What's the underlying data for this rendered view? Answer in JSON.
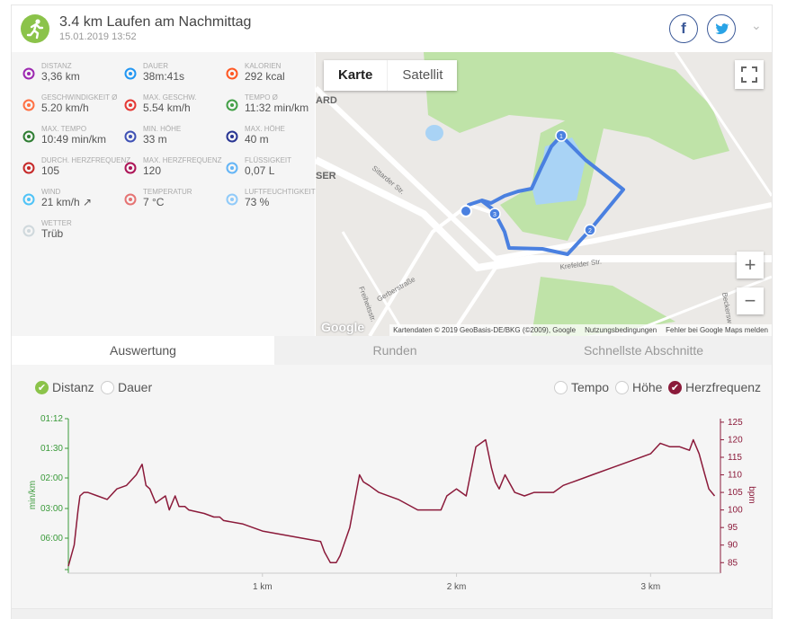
{
  "activity": {
    "title": "3.4 km Laufen am Nachmittag",
    "datetime": "15.01.2019 13:52",
    "icon": "runner-icon",
    "accent": "#8bc34a"
  },
  "social": {
    "facebook": "f",
    "twitter": "twitter-icon"
  },
  "stats": [
    {
      "label": "DISTANZ",
      "value": "3,36 km",
      "icon": "route-icon",
      "color": "#9c27b0"
    },
    {
      "label": "DAUER",
      "value": "38m:41s",
      "icon": "stopwatch-icon",
      "color": "#2196f3"
    },
    {
      "label": "KALORIEN",
      "value": "292 kcal",
      "icon": "flame-icon",
      "color": "#ff5722"
    },
    {
      "label": "GESCHWINDIGKEIT Ø",
      "value": "5.20 km/h",
      "icon": "speedometer-icon",
      "color": "#ff7043"
    },
    {
      "label": "MAX. GESCHW.",
      "value": "5.54 km/h",
      "icon": "speedometer-icon",
      "color": "#e53935"
    },
    {
      "label": "TEMPO Ø",
      "value": "11:32 min/km",
      "icon": "gauge-icon",
      "color": "#43a047"
    },
    {
      "label": "MAX. TEMPO",
      "value": "10:49 min/km",
      "icon": "gauge-icon",
      "color": "#2e7d32"
    },
    {
      "label": "MIN. HÖHE",
      "value": "33 m",
      "icon": "mountain-icon",
      "color": "#3f51b5"
    },
    {
      "label": "MAX. HÖHE",
      "value": "40 m",
      "icon": "mountain-icon",
      "color": "#283593"
    },
    {
      "label": "DURCH. HERZFREQUENZ",
      "value": "105",
      "icon": "heartbeat-icon",
      "color": "#c62828"
    },
    {
      "label": "MAX. HERZFREQUENZ",
      "value": "120",
      "icon": "heart-icon",
      "color": "#ad1457"
    },
    {
      "label": "FLÜSSIGKEIT",
      "value": "0,07 L",
      "icon": "drops-icon",
      "color": "#64b5f6"
    },
    {
      "label": "WIND",
      "value": "21 km/h ↗",
      "icon": "wind-icon",
      "color": "#4fc3f7"
    },
    {
      "label": "TEMPERATUR",
      "value": "7 °C",
      "icon": "thermometer-icon",
      "color": "#e57373"
    },
    {
      "label": "LUFTFEUCHTIGKEIT",
      "value": "73 %",
      "icon": "humidity-icon",
      "color": "#90caf9"
    },
    {
      "label": "WETTER",
      "value": "Trüb",
      "icon": "cloud-icon",
      "color": "#cfd8dc"
    }
  ],
  "map": {
    "tab_map": "Karte",
    "tab_satellite": "Satellit",
    "zoom_in": "+",
    "zoom_out": "−",
    "logo": "Google",
    "attribution": "Kartendaten © 2019 GeoBasis-DE/BKG (©2009), Google",
    "terms": "Nutzungsbedingungen",
    "report": "Fehler bei Google Maps melden",
    "streets": [
      "Sittarder Str.",
      "Krefelder Str.",
      "Gerberstraße",
      "Freiheitsstr.",
      "Beckersw"
    ],
    "place_fragments": [
      "ARD",
      "SER"
    ],
    "markers": [
      "1",
      "2",
      "3"
    ]
  },
  "tabs": [
    "Auswertung",
    "Runden",
    "Schnellste Abschnitte"
  ],
  "chart_toggles": {
    "left": [
      {
        "label": "Distanz",
        "checked": true
      },
      {
        "label": "Dauer",
        "checked": false
      }
    ],
    "right": [
      {
        "label": "Tempo",
        "checked": false
      },
      {
        "label": "Höhe",
        "checked": false
      },
      {
        "label": "Herzfrequenz",
        "checked": true
      }
    ]
  },
  "chart_data": {
    "type": "line",
    "x_label_ticks": [
      "1 km",
      "2 km",
      "3 km"
    ],
    "xlim": [
      0,
      3.36
    ],
    "y_left": {
      "label": "min/km",
      "ticks": [
        "01:12",
        "01:30",
        "02:00",
        "03:00",
        "06:00"
      ],
      "color": "#3a9a3a"
    },
    "y_right": {
      "label": "bpm",
      "ticks": [
        125,
        120,
        115,
        110,
        105,
        100,
        95,
        90,
        85
      ],
      "ylim": [
        82,
        126
      ],
      "color": "#8b1a3a"
    },
    "series": [
      {
        "name": "Herzfrequenz",
        "color": "#8b1a3a",
        "x": [
          0.0,
          0.03,
          0.05,
          0.06,
          0.08,
          0.1,
          0.15,
          0.2,
          0.25,
          0.3,
          0.35,
          0.38,
          0.4,
          0.42,
          0.45,
          0.5,
          0.52,
          0.55,
          0.57,
          0.6,
          0.62,
          0.7,
          0.75,
          0.78,
          0.8,
          0.9,
          1.0,
          1.1,
          1.2,
          1.3,
          1.32,
          1.35,
          1.38,
          1.4,
          1.45,
          1.5,
          1.52,
          1.55,
          1.6,
          1.7,
          1.8,
          1.9,
          1.92,
          1.95,
          2.0,
          2.05,
          2.1,
          2.15,
          2.18,
          2.2,
          2.22,
          2.25,
          2.3,
          2.35,
          2.4,
          2.5,
          2.55,
          2.6,
          2.65,
          2.7,
          2.8,
          2.9,
          3.0,
          3.05,
          3.1,
          3.15,
          3.2,
          3.22,
          3.25,
          3.28,
          3.3,
          3.33
        ],
        "y": [
          84,
          90,
          100,
          104,
          105,
          105,
          104,
          103,
          106,
          107,
          110,
          113,
          107,
          106,
          102,
          104,
          100,
          104,
          101,
          101,
          100,
          99,
          98,
          98,
          97,
          96,
          94,
          93,
          92,
          91,
          88,
          85,
          85,
          87,
          95,
          110,
          108,
          107,
          105,
          103,
          100,
          100,
          100,
          104,
          106,
          104,
          118,
          120,
          112,
          108,
          106,
          110,
          105,
          104,
          105,
          105,
          107,
          108,
          109,
          110,
          112,
          114,
          116,
          119,
          118,
          118,
          117,
          120,
          116,
          110,
          106,
          104
        ]
      }
    ]
  }
}
